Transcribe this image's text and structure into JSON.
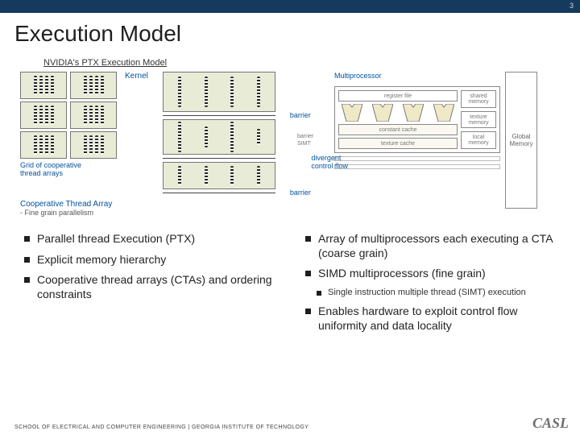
{
  "slide": {
    "page_number": "3",
    "title": "Execution  Model",
    "subtitle": "NVIDIA's PTX Execution Model"
  },
  "fig_left": {
    "kernel_label": "Kernel",
    "grid_caption_l1": "Grid of cooperative",
    "grid_caption_l2": "thread arrays",
    "cta_caption": "Cooperative Thread Array",
    "cta_sub": "- Fine grain parallelism",
    "barrier": "barrier",
    "divergent_l1": "divergent",
    "divergent_l2": "control flow"
  },
  "fig_right": {
    "mp_title": "Multiprocessor",
    "register_file": "register file",
    "const_cache": "constant cache",
    "tex_cache": "texture cache",
    "shared_mem": "shared memory",
    "tex_mem": "texture memory",
    "local_mem": "local memory",
    "global_mem": "Global Memory",
    "barrier": "barrier",
    "simt": "SIMT"
  },
  "bullets": {
    "left": {
      "b1": "Parallel thread Execution (PTX)",
      "b2": "Explicit memory hierarchy",
      "b3": "Cooperative thread arrays (CTAs) and ordering constraints"
    },
    "right": {
      "b1": "Array of multiprocessors each executing a CTA (coarse grain)",
      "b2": "SIMD multiprocessors (fine grain)",
      "b2s1": "Single instruction multiple thread (SIMT) execution",
      "b3": "Enables hardware to exploit control flow uniformity and data locality"
    }
  },
  "footer": "SCHOOL OF ELECTRICAL AND COMPUTER ENGINEERING | GEORGIA INSTITUTE OF TECHNOLOGY",
  "logo": "CASL"
}
